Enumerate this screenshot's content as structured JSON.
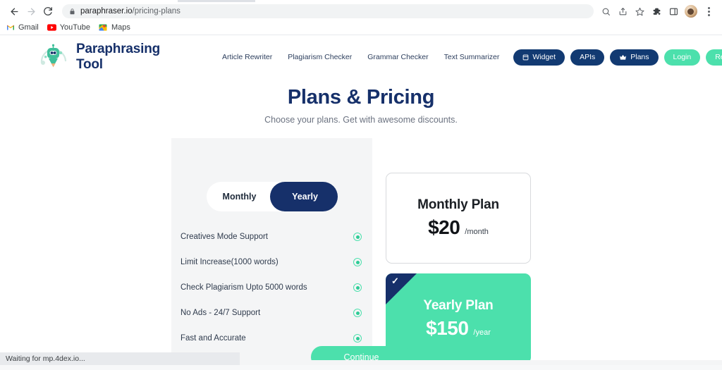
{
  "browser": {
    "back_icon": "back-arrow-icon",
    "forward_icon": "forward-arrow-icon",
    "reload_icon": "reload-icon",
    "url_host": "paraphraser.io",
    "url_path": "/pricing-plans",
    "lock_icon": "lock-icon",
    "toolbar_icons": [
      "search-icon",
      "share-icon",
      "bookmark-star-icon",
      "extensions-puzzle-icon",
      "side-panel-icon",
      "profile-avatar",
      "chrome-menu-icon"
    ],
    "bookmarks": [
      {
        "label": "Gmail",
        "icon": "gmail-icon"
      },
      {
        "label": "YouTube",
        "icon": "youtube-icon"
      },
      {
        "label": "Maps",
        "icon": "maps-icon"
      }
    ],
    "status_text": "Waiting for mp.4dex.io..."
  },
  "site": {
    "brand": "Paraphrasing Tool",
    "brand_logo": "robot-pencil-mascot-logo",
    "nav_links": [
      "Article Rewriter",
      "Plagiarism Checker",
      "Grammar Checker",
      "Text Summarizer"
    ],
    "nav_buttons": [
      {
        "label": "Widget",
        "style": "navy",
        "icon": "widget-icon"
      },
      {
        "label": "APIs",
        "style": "navy",
        "icon": ""
      },
      {
        "label": "Plans",
        "style": "navy",
        "icon": "crown-icon"
      },
      {
        "label": "Login",
        "style": "green",
        "icon": ""
      },
      {
        "label": "Register",
        "style": "green",
        "icon": ""
      }
    ]
  },
  "hero": {
    "title": "Plans & Pricing",
    "subtitle": "Choose your plans. Get with awesome discounts."
  },
  "pricing": {
    "billing_toggle": {
      "monthly_label": "Monthly",
      "yearly_label": "Yearly",
      "selected": "Yearly"
    },
    "features": [
      "Creatives Mode Support",
      "Limit Increase(1000 words)",
      "Check Plagiarism Upto 5000 words",
      "No Ads - 24/7 Support",
      "Fast and Accurate"
    ],
    "plans": [
      {
        "name": "Monthly Plan",
        "price": "$20",
        "period": "/month",
        "selected": false
      },
      {
        "name": "Yearly Plan",
        "price": "$150",
        "period": "/year",
        "selected": true,
        "check_glyph": "✓"
      }
    ],
    "continue_label": "Continue"
  },
  "colors": {
    "navy": "#16306a",
    "green": "#4ce0ac",
    "panel_grey": "#f4f5f6",
    "text_dark": "#2f3b4d"
  }
}
